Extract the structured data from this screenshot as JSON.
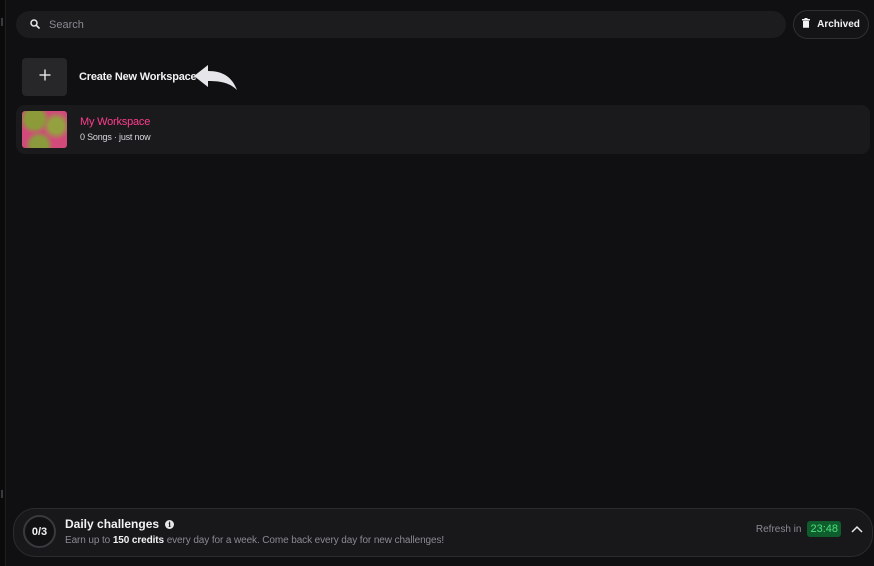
{
  "search": {
    "placeholder": "Search",
    "value": ""
  },
  "toolbar": {
    "archived_label": "Archived"
  },
  "create": {
    "label": "Create New Workspace"
  },
  "workspaces": [
    {
      "name": "My Workspace",
      "meta": "0 Songs · just now"
    }
  ],
  "challenges": {
    "progress": "0/3",
    "title": "Daily challenges",
    "desc_pre": "Earn up to",
    "credits": "150 credits",
    "desc_post": "every day for a week. Come back every day for new challenges!",
    "refresh_label": "Refresh in",
    "timer": "23:48"
  },
  "colors": {
    "background": "#101012",
    "accent_pink": "#ff3d8e",
    "timer_bg": "#0f5c2c",
    "timer_text": "#4ce07e"
  },
  "icons": [
    "search-icon",
    "trash-icon",
    "plus-icon",
    "curved-arrow-icon",
    "info-icon",
    "chevron-up-icon"
  ]
}
